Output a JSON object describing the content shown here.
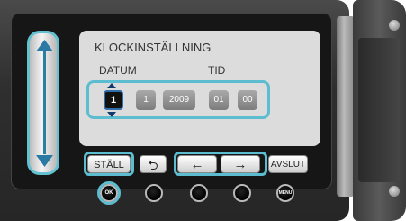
{
  "screen": {
    "title": "KLOCKINSTÄLLNING",
    "date_label": "DATUM",
    "time_label": "TID"
  },
  "fields": {
    "day": "1",
    "month": "1",
    "year": "2009",
    "hour": "01",
    "minute": "00"
  },
  "buttons": {
    "set": "STÄLL",
    "back": "⮌",
    "left": "←",
    "right": "→",
    "quit": "AVSLUT"
  },
  "hardware": {
    "ok": "OK",
    "menu": "MENU"
  },
  "colors": {
    "highlight": "#5dbdd0",
    "screen_bg": "#dcdcdc"
  }
}
